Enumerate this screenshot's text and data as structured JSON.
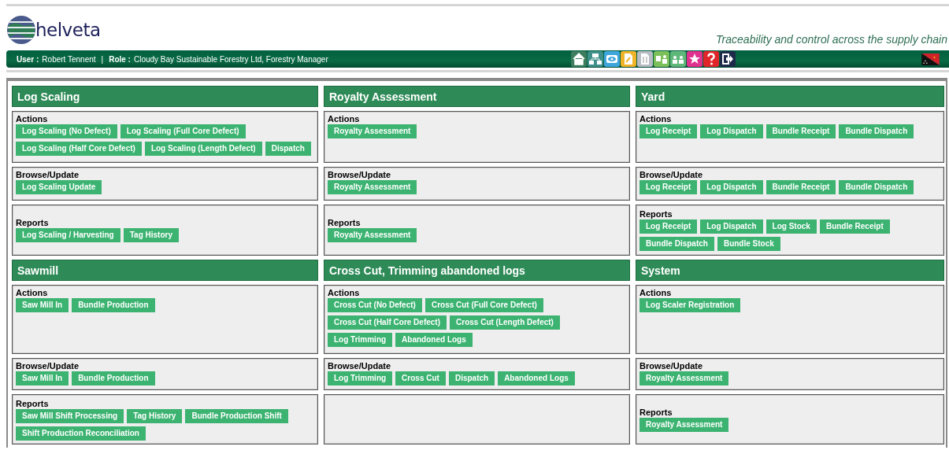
{
  "header": {
    "logo_text": "helveta",
    "tagline": "Traceability and control across the supply chain"
  },
  "user_bar": {
    "user_label": "User :",
    "user": "Robert Tennent",
    "separator": "|",
    "role_label": "Role :",
    "role": "Cloudy Bay Sustainable Forestry Ltd, Forestry Manager"
  },
  "modules": [
    {
      "title": "Log Scaling",
      "sections": [
        {
          "kind": "actions",
          "title": "Actions",
          "buttons": [
            "Log Scaling (No Defect)",
            "Log Scaling (Full Core Defect)",
            "Log Scaling (Half Core Defect)",
            "Log Scaling (Length Defect)",
            "Dispatch"
          ]
        },
        {
          "kind": "browse",
          "title": "Browse/Update",
          "buttons": [
            "Log Scaling Update"
          ]
        },
        {
          "kind": "reports",
          "title": "Reports",
          "buttons": [
            "Log Scaling / Harvesting",
            "Tag History"
          ]
        }
      ]
    },
    {
      "title": "Royalty Assessment",
      "sections": [
        {
          "kind": "actions",
          "title": "Actions",
          "buttons": [
            "Royalty Assessment"
          ]
        },
        {
          "kind": "browse",
          "title": "Browse/Update",
          "buttons": [
            "Royalty Assessment"
          ]
        },
        {
          "kind": "reports",
          "title": "Reports",
          "buttons": [
            "Royalty Assessment"
          ]
        }
      ]
    },
    {
      "title": "Yard",
      "sections": [
        {
          "kind": "actions",
          "title": "Actions",
          "buttons": [
            "Log Receipt",
            "Log Dispatch",
            "Bundle Receipt",
            "Bundle Dispatch"
          ]
        },
        {
          "kind": "browse",
          "title": "Browse/Update",
          "buttons": [
            "Log Receipt",
            "Log Dispatch",
            "Bundle Receipt",
            "Bundle Dispatch"
          ]
        },
        {
          "kind": "reports",
          "title": "Reports",
          "buttons": [
            "Log Receipt",
            "Log Dispatch",
            "Log Stock",
            "Bundle Receipt",
            "Bundle Dispatch",
            "Bundle Stock"
          ]
        }
      ]
    },
    {
      "title": "Sawmill",
      "sections": [
        {
          "kind": "actions",
          "title": "Actions",
          "buttons": [
            "Saw Mill In",
            "Bundle Production"
          ]
        },
        {
          "kind": "browse",
          "title": "Browse/Update",
          "buttons": [
            "Saw Mill In",
            "Bundle Production"
          ]
        },
        {
          "kind": "reports",
          "title": "Reports",
          "buttons": [
            "Saw Mill Shift Processing",
            "Tag History",
            "Bundle Production Shift",
            "Shift Production Reconciliation"
          ]
        }
      ]
    },
    {
      "title": "Cross Cut, Trimming abandoned logs",
      "sections": [
        {
          "kind": "actions",
          "title": "Actions",
          "buttons": [
            "Cross Cut (No Defect)",
            "Cross Cut (Full Core Defect)",
            "Cross Cut (Half Core Defect)",
            "Cross Cut (Length Defect)",
            "Log Trimming",
            "Abandoned Logs"
          ]
        },
        {
          "kind": "browse",
          "title": "Browse/Update",
          "buttons": [
            "Log Trimming",
            "Cross Cut",
            "Dispatch",
            "Abandoned Logs"
          ]
        },
        {
          "kind": "reports"
        }
      ]
    },
    {
      "title": "System",
      "sections": [
        {
          "kind": "actions",
          "title": "Actions",
          "buttons": [
            "Log Scaler Registration"
          ]
        },
        {
          "kind": "browse",
          "title": "Browse/Update",
          "buttons": [
            "Royalty Assessment"
          ]
        },
        {
          "kind": "reports",
          "title": "Reports",
          "buttons": [
            "Royalty Assessment"
          ]
        }
      ]
    }
  ]
}
